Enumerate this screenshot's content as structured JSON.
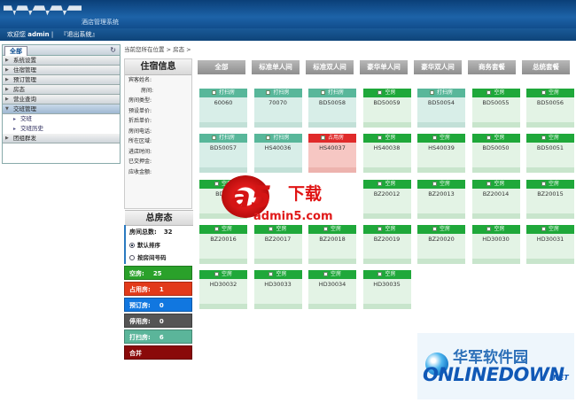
{
  "header": {
    "system_title": "酒店管理系统"
  },
  "userbar": {
    "welcome": "欢迎您",
    "username": "admin",
    "separator": "|",
    "logout": "『退出系统』"
  },
  "sidebar": {
    "tab": "全部",
    "refresh_icon": "refresh-icon",
    "items": [
      {
        "label": "系统设置"
      },
      {
        "label": "住宿管理"
      },
      {
        "label": "预订管理"
      },
      {
        "label": "房态"
      },
      {
        "label": "营业查询"
      },
      {
        "label": "交班管理"
      }
    ],
    "subitems": [
      {
        "label": "交班"
      },
      {
        "label": "交班历史"
      }
    ],
    "last_item": "团组群发"
  },
  "breadcrumb": "当前您所在位置 > 房态 >",
  "stay_info": {
    "title": "住宿信息",
    "fields": [
      "宾客姓名:",
      "房间:",
      "房间类型:",
      "预设单价:",
      "折后单价:",
      "房间电话:",
      "所在区域:",
      "进店时间:",
      "已交押金:",
      "应收金额:"
    ]
  },
  "room_status": {
    "title": "总房态",
    "total_label": "房间总数:",
    "total_value": "32",
    "sort_default": "默认排序",
    "sort_number": "按房间号码",
    "stats": [
      {
        "label": "空房:",
        "value": "25",
        "color": "#2aa12a"
      },
      {
        "label": "占用房:",
        "value": "1",
        "color": "#e23a1a"
      },
      {
        "label": "预订房:",
        "value": "0",
        "color": "#1177e0"
      },
      {
        "label": "停用房:",
        "value": "0",
        "color": "#555555"
      },
      {
        "label": "打扫房:",
        "value": "6",
        "color": "#5bb59a"
      },
      {
        "label": "合并",
        "value": "",
        "color": "#8a0a0a"
      }
    ]
  },
  "tabs": [
    "全部",
    "标准单人间",
    "标准双人间",
    "豪华单人间",
    "豪华双人间",
    "商务套餐",
    "总统套餐"
  ],
  "rooms": [
    {
      "no": "60060",
      "status": "打扫房",
      "kind": "clean",
      "row": 0,
      "col": 0
    },
    {
      "no": "70070",
      "status": "打扫房",
      "kind": "clean",
      "row": 0,
      "col": 1
    },
    {
      "no": "BD50058",
      "status": "打扫房",
      "kind": "clean",
      "row": 0,
      "col": 2
    },
    {
      "no": "BD50059",
      "status": "空房",
      "kind": "empty",
      "row": 0,
      "col": 3
    },
    {
      "no": "BD50054",
      "status": "打扫房",
      "kind": "clean",
      "row": 0,
      "col": 4
    },
    {
      "no": "BD50055",
      "status": "空房",
      "kind": "empty",
      "row": 0,
      "col": 5
    },
    {
      "no": "BD50056",
      "status": "空房",
      "kind": "empty",
      "row": 0,
      "col": 6
    },
    {
      "no": "BD50057",
      "status": "打扫房",
      "kind": "clean",
      "row": 1,
      "col": 0
    },
    {
      "no": "HS40036",
      "status": "打扫房",
      "kind": "clean",
      "row": 1,
      "col": 1
    },
    {
      "no": "HS40037",
      "status": "占用房",
      "kind": "occ",
      "row": 1,
      "col": 2
    },
    {
      "no": "HS40038",
      "status": "空房",
      "kind": "empty",
      "row": 1,
      "col": 3
    },
    {
      "no": "HS40039",
      "status": "空房",
      "kind": "empty",
      "row": 1,
      "col": 4
    },
    {
      "no": "BD50050",
      "status": "空房",
      "kind": "empty",
      "row": 1,
      "col": 5
    },
    {
      "no": "BD50051",
      "status": "空房",
      "kind": "empty",
      "row": 1,
      "col": 6
    },
    {
      "no": "BD50",
      "status": "空房",
      "kind": "empty",
      "row": 2,
      "col": 0
    },
    {
      "no": "BZ20012",
      "status": "空房",
      "kind": "empty",
      "row": 2,
      "col": 3
    },
    {
      "no": "BZ20013",
      "status": "空房",
      "kind": "empty",
      "row": 2,
      "col": 4
    },
    {
      "no": "BZ20014",
      "status": "空房",
      "kind": "empty",
      "row": 2,
      "col": 5
    },
    {
      "no": "BZ20015",
      "status": "空房",
      "kind": "empty",
      "row": 2,
      "col": 6
    },
    {
      "no": "BZ20016",
      "status": "空房",
      "kind": "empty",
      "row": 3,
      "col": 0
    },
    {
      "no": "BZ20017",
      "status": "空房",
      "kind": "empty",
      "row": 3,
      "col": 1
    },
    {
      "no": "BZ20018",
      "status": "空房",
      "kind": "empty",
      "row": 3,
      "col": 2
    },
    {
      "no": "BZ20019",
      "status": "空房",
      "kind": "empty",
      "row": 3,
      "col": 3
    },
    {
      "no": "BZ20020",
      "status": "空房",
      "kind": "empty",
      "row": 3,
      "col": 4
    },
    {
      "no": "HD30030",
      "status": "空房",
      "kind": "empty",
      "row": 3,
      "col": 5
    },
    {
      "no": "HD30031",
      "status": "空房",
      "kind": "empty",
      "row": 3,
      "col": 6
    },
    {
      "no": "HD30032",
      "status": "空房",
      "kind": "empty",
      "row": 4,
      "col": 0
    },
    {
      "no": "HD30033",
      "status": "空房",
      "kind": "empty",
      "row": 4,
      "col": 1
    },
    {
      "no": "HD30034",
      "status": "空房",
      "kind": "empty",
      "row": 4,
      "col": 2
    },
    {
      "no": "HD30035",
      "status": "空房",
      "kind": "empty",
      "row": 4,
      "col": 3
    }
  ],
  "watermarks": {
    "a5_logo": "a5",
    "a5_text": "下载",
    "a5_url": "admin5.com",
    "ol_cn": "华军软件园",
    "ol_en": "ONLINEDOWN",
    "ol_net": ".NET"
  }
}
